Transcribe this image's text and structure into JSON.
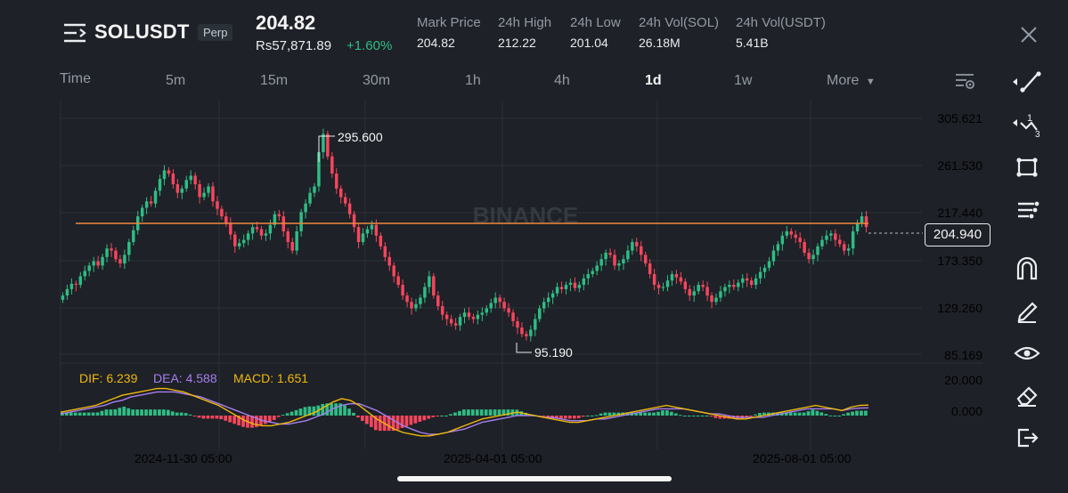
{
  "header": {
    "symbol": "SOLUSDT",
    "contract_type": "Perp",
    "last_price": "204.82",
    "local_price": "Rs57,871.89",
    "change_pct": "+1.60%",
    "stats": [
      {
        "label": "Mark Price",
        "value": "204.82"
      },
      {
        "label": "24h High",
        "value": "212.22"
      },
      {
        "label": "24h Low",
        "value": "201.04"
      },
      {
        "label": "24h Vol(SOL)",
        "value": "26.18M"
      },
      {
        "label": "24h Vol(USDT)",
        "value": "5.41B"
      }
    ]
  },
  "toolbar": {
    "intervals": [
      "Time",
      "5m",
      "15m",
      "30m",
      "1h",
      "4h",
      "1d",
      "1w",
      "More"
    ],
    "active_interval": "1d"
  },
  "chart": {
    "watermark": "BINANCE",
    "price_ticks": [
      "305.621",
      "261.530",
      "217.440",
      "173.350",
      "129.260",
      "85.169"
    ],
    "current_price_label": "204.940",
    "high_marker": "295.600",
    "low_marker": "95.190",
    "date_ticks": [
      "2024-11-30 05:00",
      "2025-04-01 05:00",
      "2025-08-01 05:00"
    ],
    "macd_ticks": [
      "20.000",
      "0.000"
    ],
    "macd_legend": {
      "dif": "DIF: 6.239",
      "dea": "DEA: 4.588",
      "macd": "MACD: 1.651"
    },
    "colors": {
      "up": "#2ebd85",
      "down": "#f6465d",
      "horizontal_line": "#f0883e",
      "dif": "#f0b90b",
      "dea": "#a77ff0"
    }
  },
  "chart_data": {
    "type": "candlestick",
    "symbol": "SOLUSDT",
    "interval": "1d",
    "ylim": [
      85.169,
      305.621
    ],
    "horizontal_line_price": 207.5,
    "high": 295.6,
    "low": 95.19,
    "last": 204.94,
    "close_series": [
      140,
      146,
      151,
      150,
      158,
      163,
      168,
      172,
      168,
      176,
      184,
      182,
      174,
      170,
      178,
      190,
      201,
      214,
      222,
      228,
      226,
      238,
      249,
      257,
      254,
      244,
      236,
      240,
      248,
      252,
      244,
      232,
      236,
      242,
      228,
      221,
      214,
      208,
      197,
      186,
      189,
      192,
      198,
      204,
      202,
      196,
      198,
      206,
      216,
      214,
      200,
      190,
      182,
      200,
      218,
      226,
      236,
      242,
      274,
      291,
      270,
      254,
      240,
      232,
      226,
      216,
      204,
      190,
      198,
      202,
      206,
      196,
      186,
      176,
      168,
      158,
      150,
      140,
      134,
      128,
      132,
      138,
      148,
      158,
      140,
      130,
      122,
      118,
      114,
      112,
      120,
      124,
      120,
      118,
      122,
      124,
      128,
      133,
      138,
      134,
      128,
      124,
      116,
      110,
      104,
      102,
      108,
      118,
      128,
      134,
      138,
      142,
      148,
      146,
      150,
      152,
      147,
      150,
      156,
      160,
      163,
      168,
      174,
      180,
      178,
      168,
      170,
      174,
      182,
      190,
      186,
      178,
      170,
      160,
      150,
      147,
      148,
      154,
      160,
      157,
      153,
      146,
      140,
      144,
      150,
      148,
      140,
      134,
      138,
      144,
      148,
      150,
      148,
      152,
      156,
      154,
      150,
      156,
      162,
      166,
      172,
      182,
      188,
      196,
      200,
      197,
      194,
      190,
      180,
      174,
      178,
      186,
      192,
      196,
      198,
      192,
      188,
      182,
      184,
      200,
      208,
      214,
      204
    ],
    "macd_dif": [
      2,
      3,
      4,
      5,
      6,
      8,
      10,
      12,
      13,
      14,
      15,
      16,
      16,
      15,
      14,
      12,
      10,
      8,
      6,
      3,
      0,
      -3,
      -5,
      -6,
      -6,
      -5,
      -4,
      -2,
      0,
      2,
      5,
      8,
      10,
      9,
      6,
      2,
      -2,
      -5,
      -8,
      -10,
      -11,
      -12,
      -12,
      -11,
      -10,
      -8,
      -6,
      -4,
      -2,
      -1,
      0,
      1,
      2,
      1,
      0,
      -1,
      -2,
      -3,
      -4,
      -4,
      -3,
      -2,
      -1,
      0,
      1,
      2,
      3,
      4,
      5,
      6,
      5,
      4,
      3,
      2,
      1,
      0,
      -1,
      -2,
      -2,
      -1,
      0,
      1,
      2,
      3,
      4,
      5,
      6,
      5,
      4,
      3,
      5,
      6,
      6.2
    ],
    "macd_dea": [
      1,
      2,
      3,
      4,
      5,
      6,
      8,
      9,
      11,
      12,
      13,
      14,
      14,
      14,
      13,
      12,
      11,
      9,
      7,
      5,
      3,
      1,
      -1,
      -3,
      -4,
      -5,
      -5,
      -4,
      -3,
      -1,
      1,
      4,
      6,
      7,
      7,
      5,
      3,
      0,
      -3,
      -6,
      -8,
      -10,
      -11,
      -11,
      -10,
      -9,
      -8,
      -6,
      -4,
      -3,
      -2,
      -1,
      0,
      0,
      0,
      -1,
      -1,
      -2,
      -3,
      -3,
      -3,
      -2,
      -2,
      -1,
      0,
      1,
      2,
      3,
      4,
      4,
      4,
      4,
      3,
      2,
      1,
      1,
      0,
      -1,
      -1,
      -1,
      -1,
      0,
      1,
      2,
      3,
      4,
      4,
      4,
      4,
      3,
      4,
      4.4,
      4.6
    ]
  },
  "right_tools": [
    "trend-line-icon",
    "fibonacci-icon",
    "rectangle-icon",
    "indicators-icon",
    "magnet-icon",
    "pencil-icon",
    "eye-icon",
    "eraser-icon",
    "exit-icon"
  ]
}
